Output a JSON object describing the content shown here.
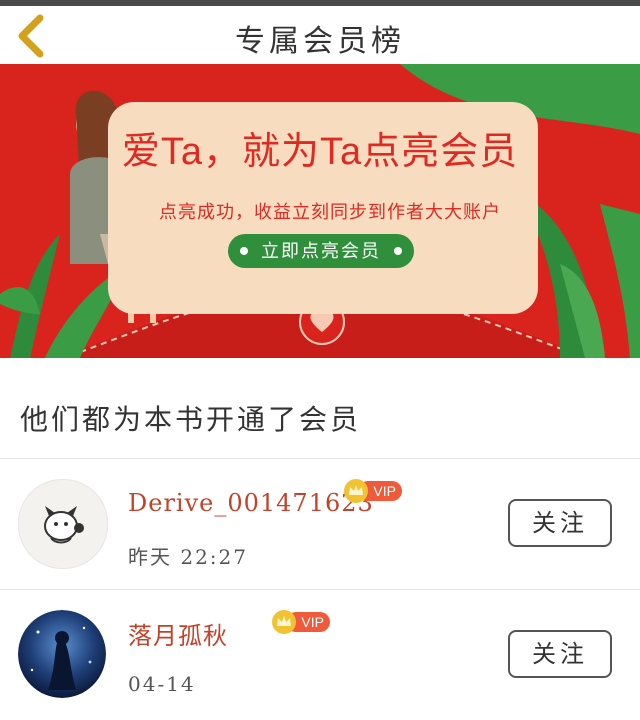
{
  "nav": {
    "title": "专属会员榜",
    "back_icon": "chevron-left-icon"
  },
  "banner": {
    "headline": "爱Ta，就为Ta点亮会员",
    "subtitle": "点亮成功，收益立刻同步到作者大大账户",
    "cta_label": "立即点亮会员",
    "colors": {
      "background": "#d9241e",
      "card": "#f8dcc0",
      "accent": "#de2a22",
      "button": "#2f8f3a"
    }
  },
  "section": {
    "title": "他们都为本书开通了会员"
  },
  "members": [
    {
      "name": "Derive_001471623",
      "badge": "VIP",
      "time": "昨天 22:27",
      "follow_label": "关注",
      "avatar_icon": "dog-avatar"
    },
    {
      "name": "落月孤秋",
      "badge": "VIP",
      "time": "04-14",
      "follow_label": "关注",
      "avatar_icon": "night-sky-avatar"
    }
  ]
}
